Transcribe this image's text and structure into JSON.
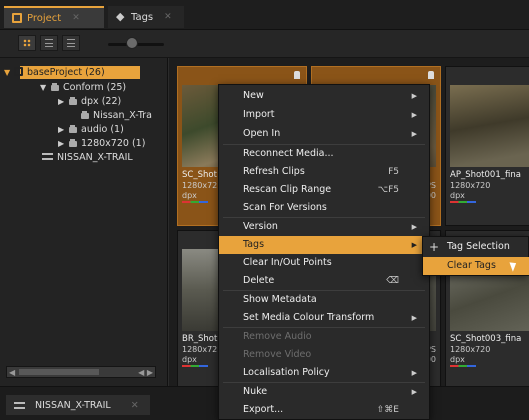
{
  "tabs": [
    {
      "label": "Project",
      "icon": "project-icon",
      "active": true
    },
    {
      "label": "Tags",
      "icon": "tag-icon",
      "active": false
    }
  ],
  "toolbar": {
    "views": [
      "grid-view-icon",
      "list-view-icon",
      "detail-view-icon"
    ]
  },
  "tree": {
    "items": [
      {
        "label": "baseProject (26)",
        "level": 0,
        "expanded": true,
        "selected": true
      },
      {
        "label": "Conform (25)",
        "level": 1,
        "expanded": true
      },
      {
        "label": "dpx (22)",
        "level": 2,
        "expanded": false
      },
      {
        "label": "Nissan_X-Tra",
        "level": 3
      },
      {
        "label": "audio (1)",
        "level": 2,
        "expanded": false
      },
      {
        "label": "1280x720 (1)",
        "level": 2,
        "expanded": false
      },
      {
        "label": "NISSAN_X-TRAIL",
        "level": 1
      }
    ]
  },
  "clips": [
    {
      "name": "SC_Shot",
      "res": "1280x72",
      "fmt": "dpx",
      "fps": "",
      "tc": "",
      "highlight": true
    },
    {
      "name": "",
      "res": "",
      "fmt": "",
      "fps": "FPS",
      "tc": ":00",
      "highlight": true
    },
    {
      "name": "AP_Shot001_fina",
      "res": "1280x720",
      "fmt": "dpx",
      "fps": "",
      "tc": "",
      "highlight": false
    },
    {
      "name": "BR_Shot",
      "res": "1280x72",
      "fmt": "dpx",
      "fps": "",
      "tc": "",
      "highlight": false
    },
    {
      "name": "",
      "res": "",
      "fmt": "",
      "fps": "FPS",
      "tc": ":00",
      "highlight": false
    },
    {
      "name": "SC_Shot003_fina",
      "res": "1280x720",
      "fmt": "dpx",
      "fps": "",
      "tc": "",
      "highlight": false
    }
  ],
  "bottom_tab": {
    "label": "NISSAN_X-TRAIL"
  },
  "context_menu": {
    "items": [
      {
        "label": "New",
        "submenu": true
      },
      {
        "label": "Import",
        "submenu": true
      },
      {
        "label": "Open In",
        "submenu": true
      },
      {
        "label": "Reconnect Media..."
      },
      {
        "label": "Refresh Clips",
        "shortcut": "F5"
      },
      {
        "label": "Rescan Clip Range",
        "shortcut": "⌥F5"
      },
      {
        "label": "Scan For Versions"
      },
      {
        "label": "Version",
        "submenu": true
      },
      {
        "label": "Tags",
        "submenu": true,
        "active": true
      },
      {
        "label": "Clear In/Out Points"
      },
      {
        "label": "Delete",
        "shortcut": "⌫"
      },
      {
        "label": "Show Metadata"
      },
      {
        "label": "Set Media Colour Transform",
        "submenu": true
      },
      {
        "label": "Remove Audio",
        "disabled": true
      },
      {
        "label": "Remove Video",
        "disabled": true
      },
      {
        "label": "Localisation Policy",
        "submenu": true
      },
      {
        "label": "Nuke",
        "submenu": true
      },
      {
        "label": "Export...",
        "shortcut": "⇧⌘E"
      }
    ]
  },
  "tags_submenu": {
    "items": [
      {
        "label": "Tag Selection",
        "icon": "plus-icon"
      },
      {
        "label": "Clear Tags",
        "active": true
      }
    ]
  },
  "colors": {
    "accent": "#e8a33c",
    "clip_highlight": "#8a5418",
    "background": "#2b2b2b"
  }
}
